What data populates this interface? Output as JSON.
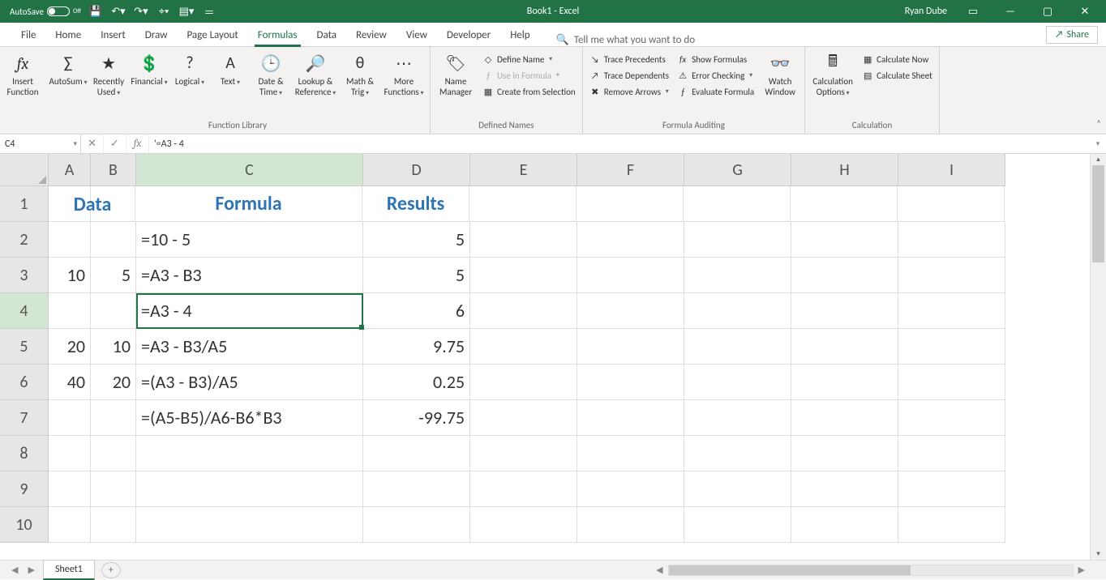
{
  "titlebar": {
    "autosave_label": "AutoSave",
    "autosave_state": "Off",
    "doc_title": "Book1  -  Excel",
    "user": "Ryan Dube"
  },
  "tabs": {
    "items": [
      "File",
      "Home",
      "Insert",
      "Draw",
      "Page Layout",
      "Formulas",
      "Data",
      "Review",
      "View",
      "Developer",
      "Help"
    ],
    "active_index": 5,
    "tellme_placeholder": "Tell me what you want to do",
    "share_label": "Share"
  },
  "ribbon": {
    "insert_function": "Insert Function",
    "library": {
      "autosum": "AutoSum",
      "recently": "Recently Used",
      "financial": "Financial",
      "logical": "Logical",
      "text": "Text",
      "datetime": "Date & Time",
      "lookup": "Lookup & Reference",
      "math": "Math & Trig",
      "more": "More Functions",
      "group_label": "Function Library"
    },
    "names": {
      "manager": "Name Manager",
      "define": "Define Name",
      "use": "Use in Formula",
      "create": "Create from Selection",
      "group_label": "Defined Names"
    },
    "auditing": {
      "precedents": "Trace Precedents",
      "dependents": "Trace Dependents",
      "remove": "Remove Arrows",
      "show": "Show Formulas",
      "error": "Error Checking",
      "evaluate": "Evaluate Formula",
      "watch": "Watch Window",
      "group_label": "Formula Auditing"
    },
    "calc": {
      "options": "Calculation Options",
      "now": "Calculate Now",
      "sheet": "Calculate Sheet",
      "group_label": "Calculation"
    }
  },
  "formulabar": {
    "cell_ref": "C4",
    "formula": "'=A3 - 4"
  },
  "grid": {
    "cols": [
      "A",
      "B",
      "C",
      "D",
      "E",
      "F",
      "G",
      "H",
      "I"
    ],
    "rows": [
      "1",
      "2",
      "3",
      "4",
      "5",
      "6",
      "7",
      "8",
      "9",
      "10"
    ],
    "selected_row": 4,
    "selected_col": "C",
    "data": {
      "A1": "Data",
      "C1": "Formula",
      "D1": "Results",
      "C2": "=10 - 5",
      "D2": "5",
      "A3": "10",
      "B3": "5",
      "C3": "=A3 - B3",
      "D3": "5",
      "C4": "=A3 - 4",
      "D4": "6",
      "A5": "20",
      "B5": "10",
      "C5": "=A3 - B3/A5",
      "D5": "9.75",
      "A6": "40",
      "B6": "20",
      "C6": "=(A3 - B3)/A5",
      "D6": "0.25",
      "C7": "=(A5-B5)/A6-B6*B3",
      "D7": "-99.75"
    }
  },
  "sheet": {
    "name": "Sheet1"
  },
  "chart_data": {
    "type": "table",
    "title": "Subtraction formulas and results",
    "columns": [
      "A",
      "B",
      "Formula",
      "Results"
    ],
    "rows": [
      {
        "A": null,
        "B": null,
        "Formula": "=10 - 5",
        "Results": 5
      },
      {
        "A": 10,
        "B": 5,
        "Formula": "=A3 - B3",
        "Results": 5
      },
      {
        "A": null,
        "B": null,
        "Formula": "=A3 - 4",
        "Results": 6
      },
      {
        "A": 20,
        "B": 10,
        "Formula": "=A3 - B3/A5",
        "Results": 9.75
      },
      {
        "A": 40,
        "B": 20,
        "Formula": "=(A3 - B3)/A5",
        "Results": 0.25
      },
      {
        "A": null,
        "B": null,
        "Formula": "=(A5-B5)/A6-B6*B3",
        "Results": -99.75
      }
    ]
  }
}
